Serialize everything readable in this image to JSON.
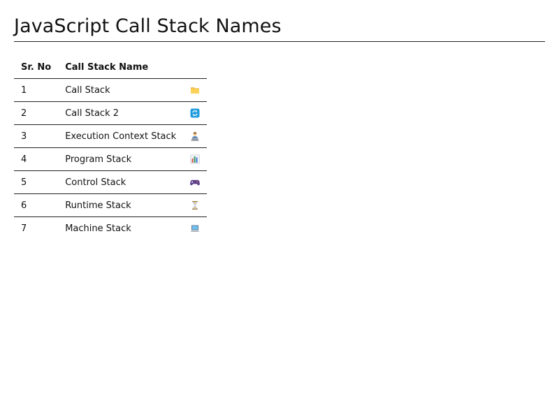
{
  "page_title": "JavaScript Call Stack Names",
  "table": {
    "headers": {
      "sr_no": "Sr. No",
      "name": "Call Stack Name"
    },
    "rows": [
      {
        "sr_no": "1",
        "name": "Call Stack",
        "icon": "folder-icon"
      },
      {
        "sr_no": "2",
        "name": "Call Stack 2",
        "icon": "refresh-icon"
      },
      {
        "sr_no": "3",
        "name": "Execution Context Stack",
        "icon": "person-at-laptop-icon"
      },
      {
        "sr_no": "4",
        "name": "Program Stack",
        "icon": "bar-chart-icon"
      },
      {
        "sr_no": "5",
        "name": "Control Stack",
        "icon": "gamepad-icon"
      },
      {
        "sr_no": "6",
        "name": "Runtime Stack",
        "icon": "hourglass-icon"
      },
      {
        "sr_no": "7",
        "name": "Machine Stack",
        "icon": "laptop-icon"
      }
    ]
  }
}
